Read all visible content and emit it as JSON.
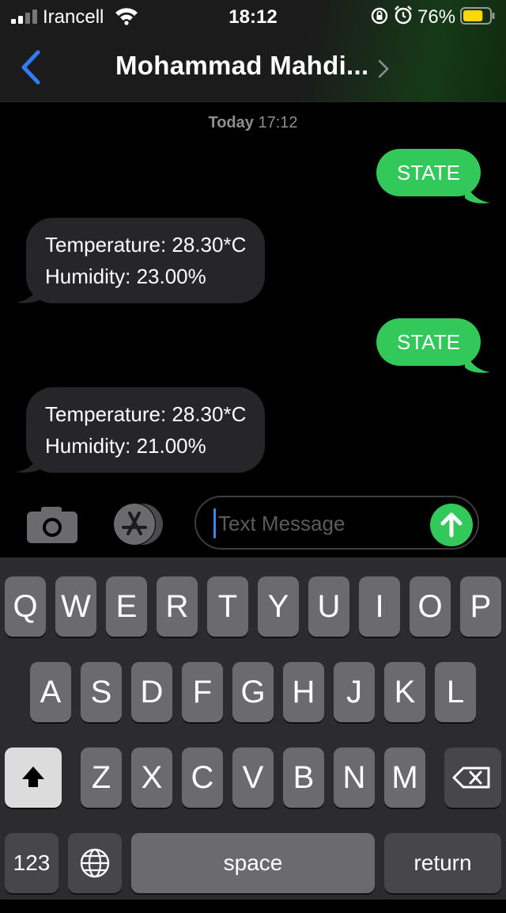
{
  "status_bar": {
    "carrier": "Irancell",
    "time": "18:12",
    "battery_percent": "76%",
    "battery_level": 0.76,
    "battery_color": "#ffd60a",
    "icons": [
      "signal-icon",
      "wifi-icon",
      "rotation-lock-icon",
      "alarm-icon",
      "battery-icon"
    ]
  },
  "nav": {
    "contact_name": "Mohammad Mahdi...",
    "back_icon": "chevron-left-icon",
    "accent": "#2f7cf6"
  },
  "conversation": {
    "date_label": "Today",
    "date_time": "17:12",
    "messages": [
      {
        "direction": "outgoing",
        "lines": [
          "STATE"
        ]
      },
      {
        "direction": "incoming",
        "lines": [
          "Temperature: 28.30*C",
          "Humidity: 23.00%"
        ]
      },
      {
        "direction": "outgoing",
        "lines": [
          "STATE"
        ]
      },
      {
        "direction": "incoming",
        "lines": [
          "Temperature: 28.30*C",
          "Humidity: 21.00%"
        ]
      }
    ],
    "outgoing_color": "#32c85a",
    "incoming_color": "#262628"
  },
  "input_bar": {
    "placeholder": "Text Message",
    "camera_icon": "camera-icon",
    "apps_icon": "app-store-icon",
    "send_icon": "arrow-up-icon"
  },
  "keyboard": {
    "row1": [
      "Q",
      "W",
      "E",
      "R",
      "T",
      "Y",
      "U",
      "I",
      "O",
      "P"
    ],
    "row2": [
      "A",
      "S",
      "D",
      "F",
      "G",
      "H",
      "J",
      "K",
      "L"
    ],
    "row3": [
      "Z",
      "X",
      "C",
      "V",
      "B",
      "N",
      "M"
    ],
    "numbers_label": "123",
    "space_label": "space",
    "return_label": "return"
  }
}
